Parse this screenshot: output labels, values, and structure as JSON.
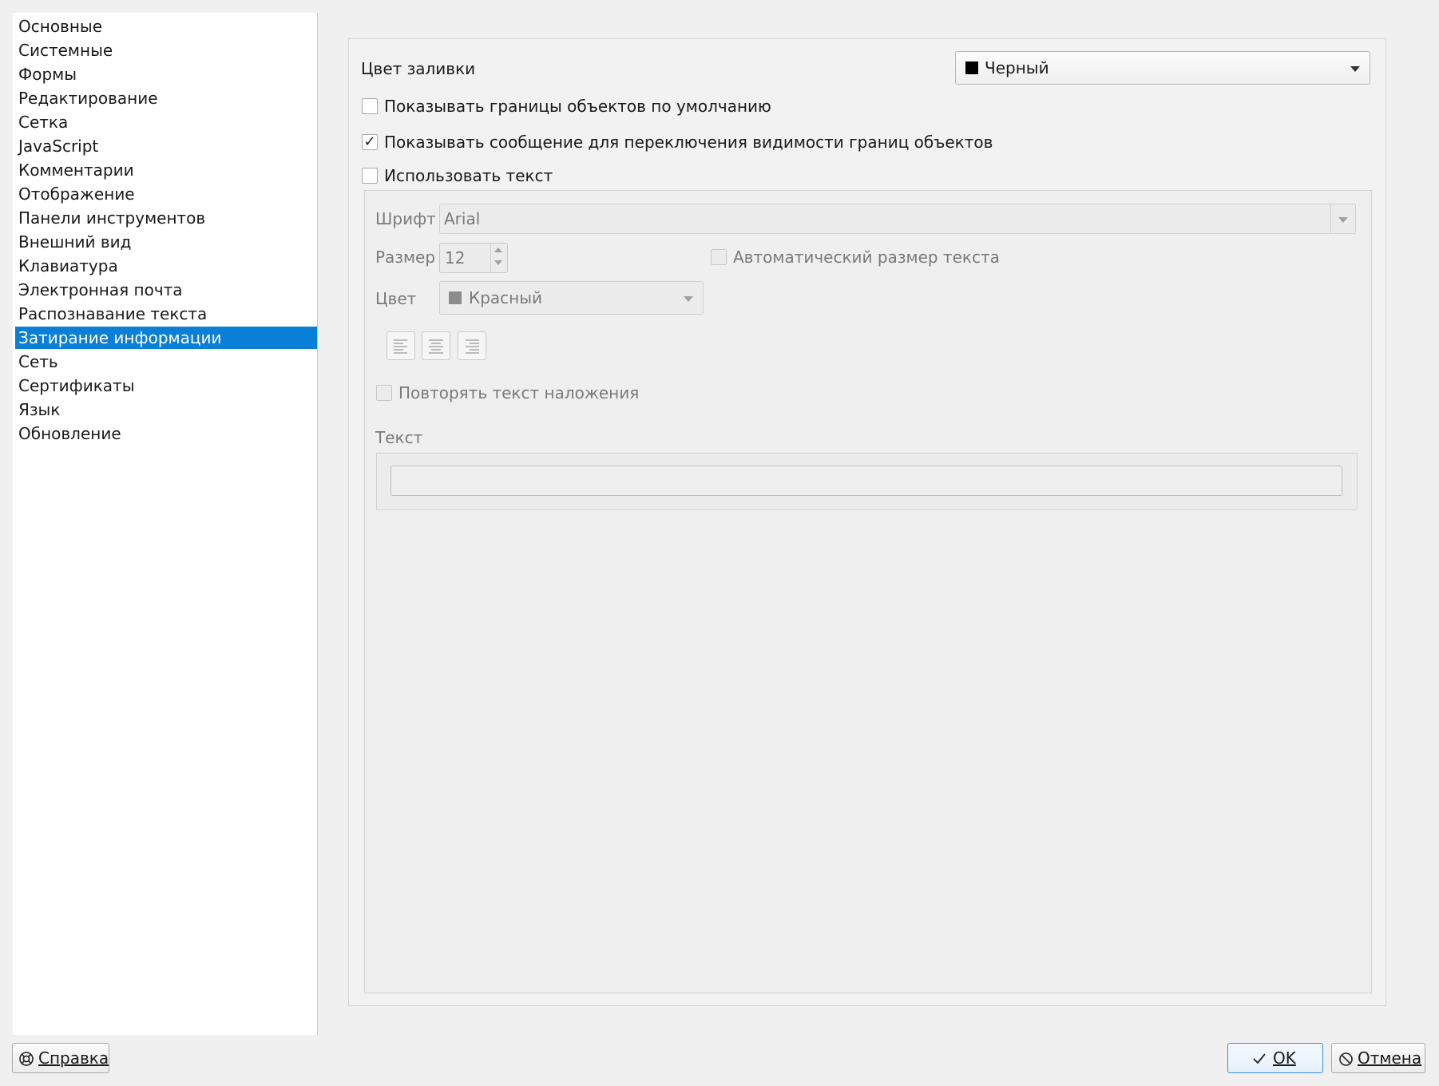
{
  "sidebar": {
    "items": [
      {
        "label": "Основные"
      },
      {
        "label": "Системные"
      },
      {
        "label": "Формы"
      },
      {
        "label": "Редактирование"
      },
      {
        "label": "Сетка"
      },
      {
        "label": "JavaScript"
      },
      {
        "label": "Комментарии"
      },
      {
        "label": "Отображение"
      },
      {
        "label": "Панели инструментов"
      },
      {
        "label": "Внешний вид"
      },
      {
        "label": "Клавиатура"
      },
      {
        "label": "Электронная почта"
      },
      {
        "label": "Распознавание текста"
      },
      {
        "label": "Затирание информации",
        "selected": true
      },
      {
        "label": "Сеть"
      },
      {
        "label": "Сертификаты"
      },
      {
        "label": "Язык"
      },
      {
        "label": "Обновление"
      }
    ]
  },
  "fill": {
    "label": "Цвет заливки",
    "value": "Черный",
    "swatch_color": "#000000"
  },
  "checks": {
    "show_borders": {
      "label": "Показывать границы объектов по умолчанию",
      "checked": false
    },
    "show_message": {
      "label": "Показывать сообщение для переключения видимости границ объектов",
      "checked": true,
      "mark": "✓"
    },
    "use_text": {
      "label": "Использовать текст",
      "checked": false
    }
  },
  "text_group": {
    "font_label": "Шрифт",
    "font_value": "Arial",
    "size_label": "Размер",
    "size_value": "12",
    "auto_size_label": "Автоматический размер текста",
    "color_label": "Цвет",
    "color_value": "Красный",
    "color_swatch": "#8c8c8c",
    "repeat_label": "Повторять текст наложения",
    "text_label": "Текст",
    "text_value": ""
  },
  "footer": {
    "help_label": "Справка",
    "ok_label": "OK",
    "cancel_label": "Отмена"
  },
  "colors": {
    "selection": "#0a7fd8",
    "ok_border": "#3d8ee0"
  }
}
